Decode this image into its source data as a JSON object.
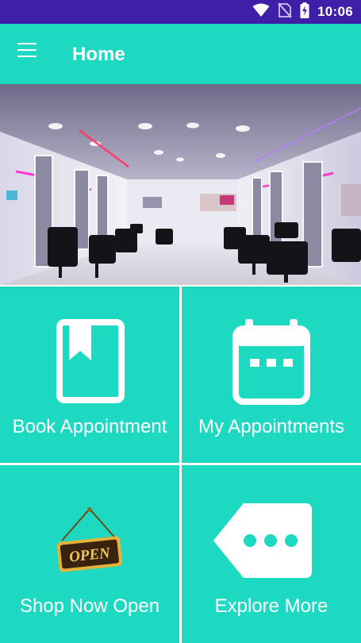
{
  "status_bar": {
    "time": "10:06",
    "icons": [
      "wifi-icon",
      "no-sim-icon",
      "battery-charging-icon"
    ]
  },
  "app_bar": {
    "title": "Home",
    "menu_icon": "hamburger-menu-icon"
  },
  "hero": {
    "description_icon": "salon-interior-photo"
  },
  "tiles": [
    {
      "label": "Book Appointment",
      "icon": "bookmark-book-icon"
    },
    {
      "label": "My Appointments",
      "icon": "calendar-icon"
    },
    {
      "label": "Shop Now Open",
      "icon": "open-sign-icon",
      "sign_text": "OPEN"
    },
    {
      "label": "Explore More",
      "icon": "more-tag-icon"
    }
  ],
  "colors": {
    "status_bar": "#3f1fa8",
    "accent": "#1ed9c2",
    "divider": "#ffffff"
  }
}
